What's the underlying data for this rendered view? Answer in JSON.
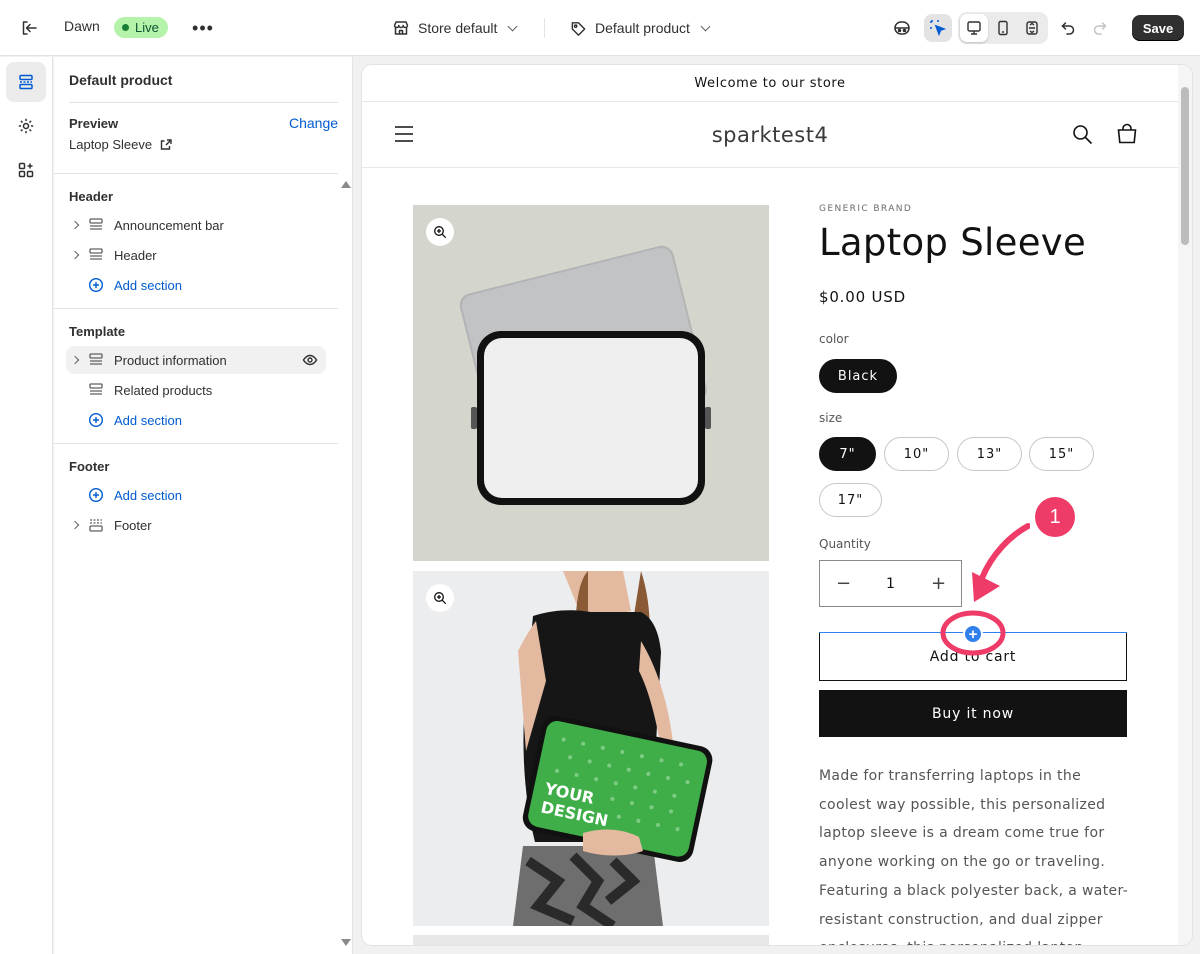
{
  "topbar": {
    "theme_name": "Dawn",
    "live_badge": "Live",
    "store_select": "Store default",
    "product_select": "Default product",
    "save_label": "Save"
  },
  "sidebar": {
    "title": "Default product",
    "preview_label": "Preview",
    "change_link": "Change",
    "preview_value": "Laptop Sleeve",
    "header_group": {
      "label": "Header",
      "items": [
        "Announcement bar",
        "Header"
      ],
      "add_section": "Add section"
    },
    "template_group": {
      "label": "Template",
      "items": [
        "Product information",
        "Related products"
      ],
      "add_section": "Add section"
    },
    "footer_group": {
      "label": "Footer",
      "add_section": "Add section",
      "items": [
        "Footer"
      ]
    }
  },
  "store": {
    "announcement": "Welcome to our store",
    "name": "sparktest4",
    "product": {
      "brand": "GENERIC BRAND",
      "title": "Laptop Sleeve",
      "price": "$0.00 USD",
      "color_label": "color",
      "colors": [
        "Black"
      ],
      "size_label": "size",
      "sizes": [
        "7\"",
        "10\"",
        "13\"",
        "15\"",
        "17\""
      ],
      "selected_size": "7\"",
      "quantity_label": "Quantity",
      "quantity": "1",
      "qty_minus": "−",
      "qty_plus": "+",
      "add_to_cart": "Add to cart",
      "buy_now": "Buy it now",
      "description": "Made for transferring laptops in the coolest way possible, this personalized laptop sleeve is a dream come true for anyone working on the go or traveling. Featuring a black polyester back, a water-resistant construction, and dual zipper enclosures, this personalized laptop",
      "design_text_1": "YOUR",
      "design_text_2": "DESIGN"
    }
  },
  "annotation": {
    "step": "1",
    "insert_plus": "+"
  },
  "colors": {
    "accent": "#005bd3",
    "live_green": "#b4f3a9",
    "annotation_pink": "#ef3b68",
    "insert_blue": "#2f80ed"
  }
}
